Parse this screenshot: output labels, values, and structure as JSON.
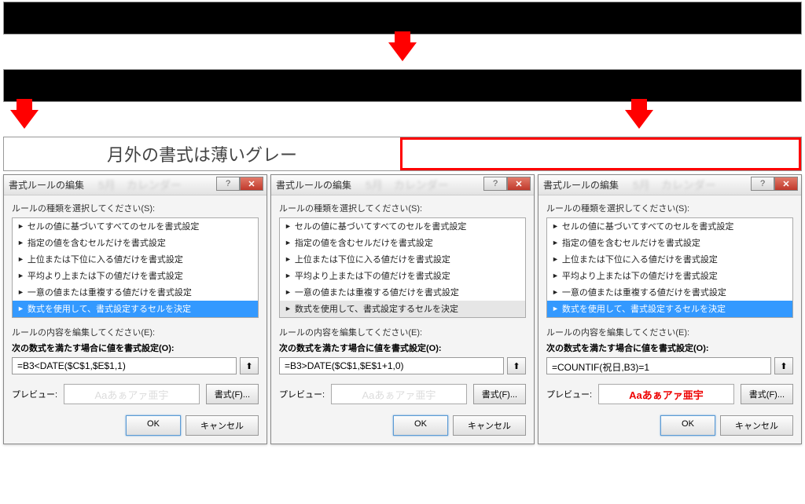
{
  "banners": {
    "label_left": "月外の書式は薄いグレー",
    "label_right": ""
  },
  "dialogs": [
    {
      "title": "書式ルールの編集",
      "blurred_bg": "5月　カレンダー",
      "rule_type_label": "ルールの種類を選択してください(S):",
      "rule_types": [
        "セルの値に基づいてすべてのセルを書式設定",
        "指定の値を含むセルだけを書式設定",
        "上位または下位に入る値だけを書式設定",
        "平均より上または下の値だけを書式設定",
        "一意の値または重複する値だけを書式設定",
        "数式を使用して、書式設定するセルを決定"
      ],
      "selected_index": 5,
      "rule_edit_label": "ルールの内容を編集してください(E):",
      "formula_label": "次の数式を満たす場合に値を書式設定(O):",
      "formula": "=B3<DATE($C$1,$E$1,1)",
      "preview_label": "プレビュー:",
      "preview_text": "Aaあぁアァ亜宇",
      "preview_style": "faded",
      "format_btn": "書式(F)...",
      "ok": "OK",
      "cancel": "キャンセル"
    },
    {
      "title": "書式ルールの編集",
      "blurred_bg": "5月　カレンダー",
      "rule_type_label": "ルールの種類を選択してください(S):",
      "rule_types": [
        "セルの値に基づいてすべてのセルを書式設定",
        "指定の値を含むセルだけを書式設定",
        "上位または下位に入る値だけを書式設定",
        "平均より上または下の値だけを書式設定",
        "一意の値または重複する値だけを書式設定",
        "数式を使用して、書式設定するセルを決定"
      ],
      "selected_index": 5,
      "selected_style": "grey",
      "rule_edit_label": "ルールの内容を編集してください(E):",
      "formula_label": "次の数式を満たす場合に値を書式設定(O):",
      "formula": "=B3>DATE($C$1,$E$1+1,0)",
      "preview_label": "プレビュー:",
      "preview_text": "Aaあぁアァ亜宇",
      "preview_style": "faded",
      "format_btn": "書式(F)...",
      "ok": "OK",
      "cancel": "キャンセル"
    },
    {
      "title": "書式ルールの編集",
      "blurred_bg": "5月　カレンダー",
      "rule_type_label": "ルールの種類を選択してください(S):",
      "rule_types": [
        "セルの値に基づいてすべてのセルを書式設定",
        "指定の値を含むセルだけを書式設定",
        "上位または下位に入る値だけを書式設定",
        "平均より上または下の値だけを書式設定",
        "一意の値または重複する値だけを書式設定",
        "数式を使用して、書式設定するセルを決定"
      ],
      "selected_index": 5,
      "rule_edit_label": "ルールの内容を編集してください(E):",
      "formula_label": "次の数式を満たす場合に値を書式設定(O):",
      "formula": "=COUNTIF(祝日,B3)=1",
      "preview_label": "プレビュー:",
      "preview_text": "Aaあぁアァ亜宇",
      "preview_style": "red",
      "format_btn": "書式(F)...",
      "ok": "OK",
      "cancel": "キャンセル"
    }
  ],
  "window_controls": {
    "help": "?",
    "close": "✕"
  },
  "ref_icon": "⬆"
}
